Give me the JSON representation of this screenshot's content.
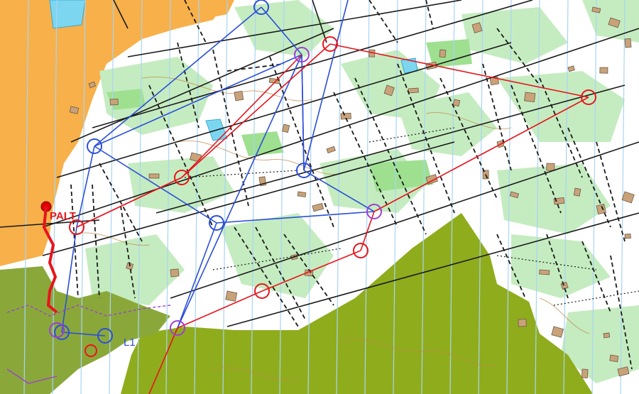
{
  "map": {
    "start_label": "PALT",
    "leg_label": "L1",
    "colors": {
      "background": "#ffffff",
      "open_land": "#f7b04a",
      "green_light": "#c5ecc0",
      "green_mid": "#9ee090",
      "dark_green": "#8fac1d",
      "water": "#7dd6f0",
      "magnetic_lines": "#a9d4f3",
      "paths": "#1a1a1a",
      "contours": "#c08a4a",
      "course_red": "#e8141c",
      "course_blue": "#2b4fd8",
      "course_purple": "#9b3fd4",
      "start_dot": "#e00000",
      "buildings": "#c9a27a"
    },
    "symbols": [
      "start-point",
      "control-circle",
      "course-leg",
      "building",
      "path",
      "vegetation",
      "magnetic-north-line"
    ]
  }
}
